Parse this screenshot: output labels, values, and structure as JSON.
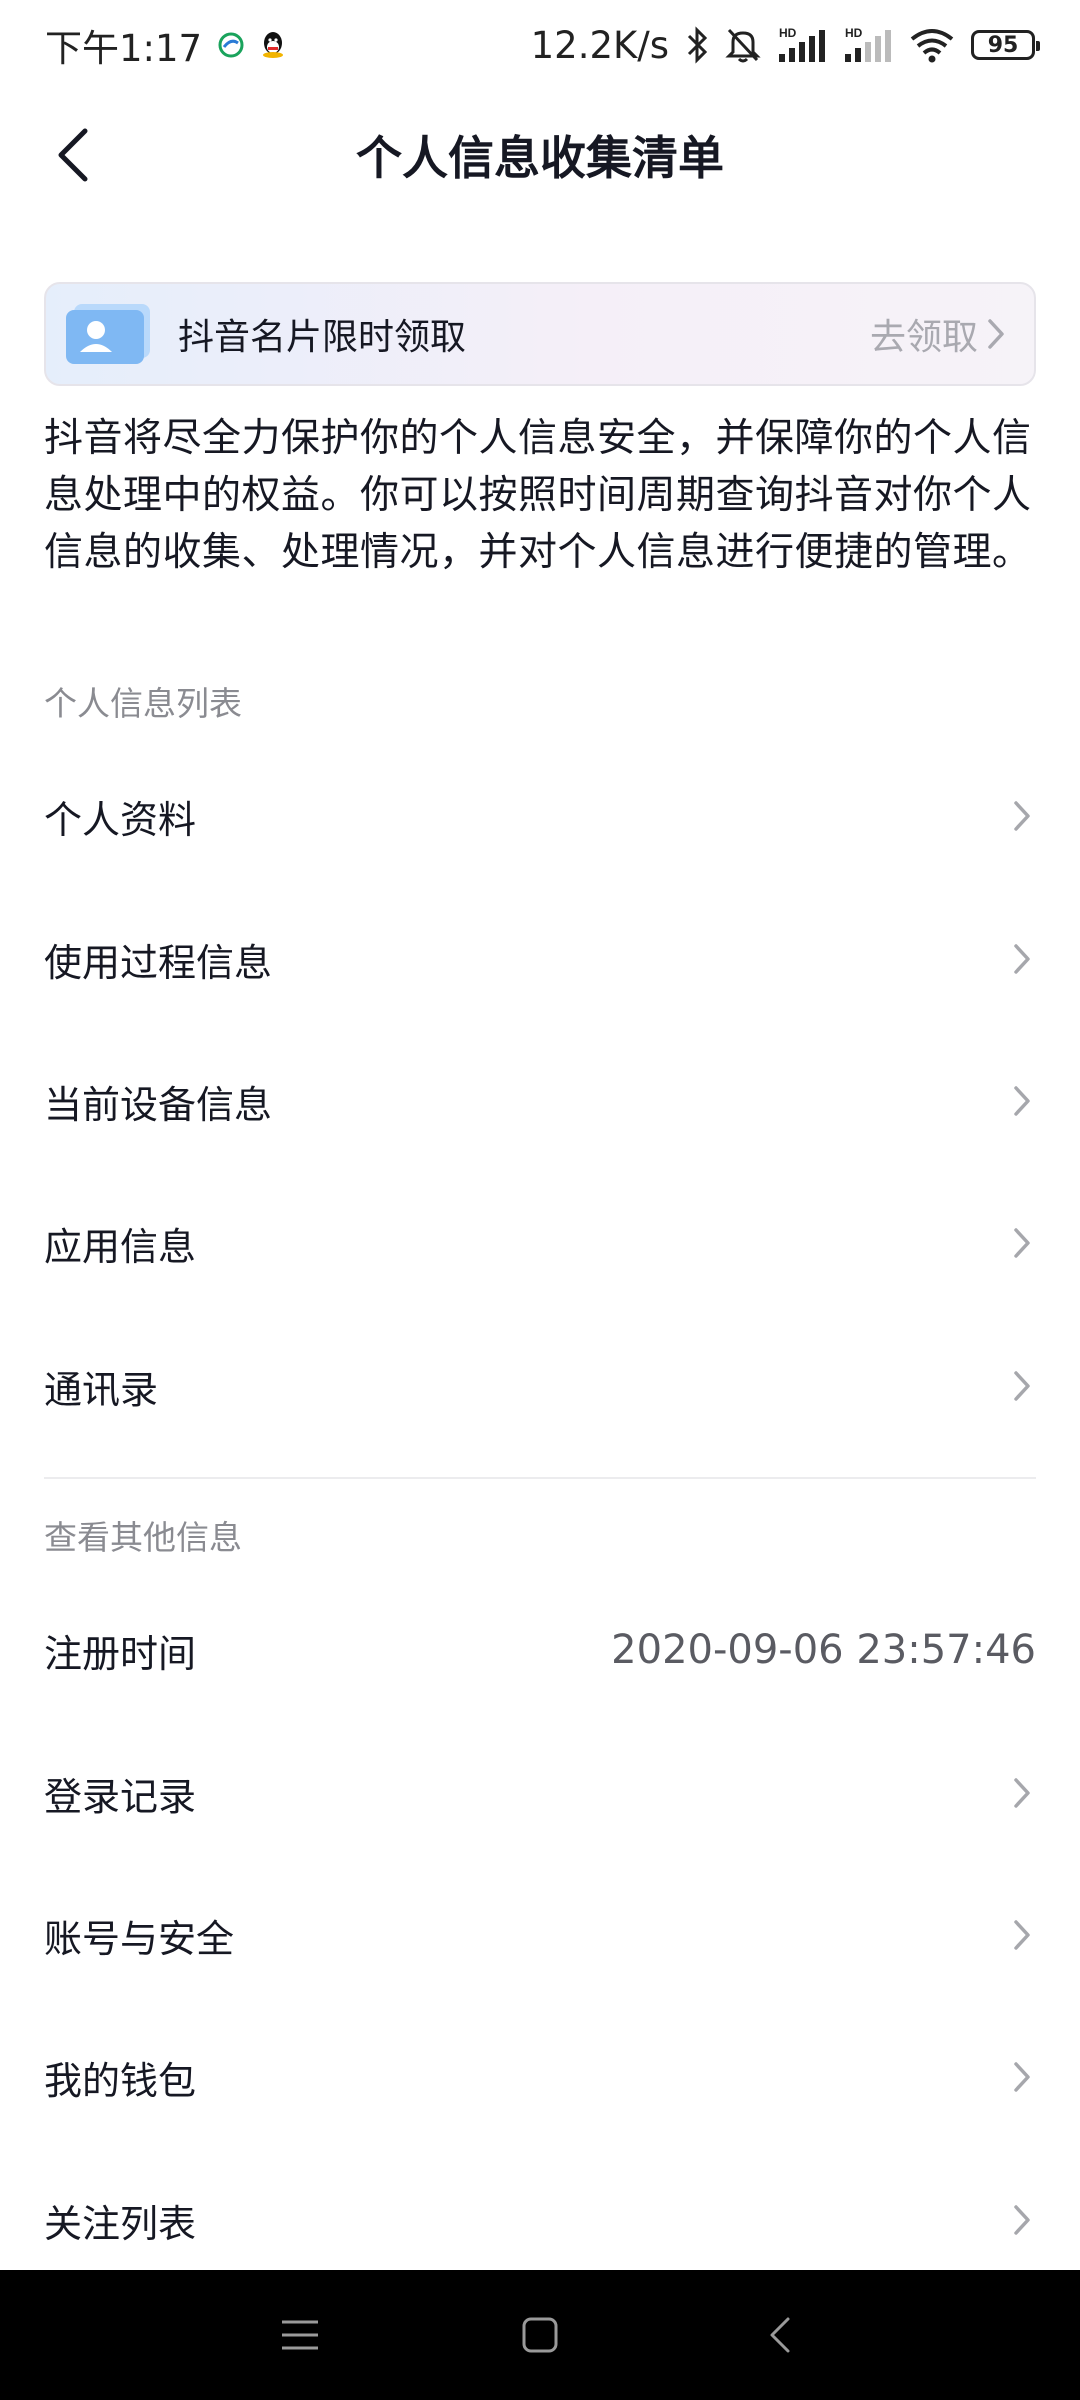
{
  "status_bar": {
    "time": "下午1:17",
    "network_speed": "12.2K/s",
    "battery": "95",
    "hd1": "HD",
    "hd2": "HD",
    "icons": [
      "carrier-icon",
      "qq-icon",
      "bluetooth-icon",
      "mute-icon",
      "signal-icon",
      "signal-icon",
      "wifi-icon",
      "battery-icon"
    ]
  },
  "header": {
    "title": "个人信息收集清单",
    "back_icon": "chevron-left-icon"
  },
  "banner": {
    "title": "抖音名片限时领取",
    "action": "去领取"
  },
  "description": "抖音将尽全力保护你的个人信息安全，并保障你的个人信息处理中的权益。你可以按照时间周期查询抖音对你个人信息的收集、处理情况，并对个人信息进行便捷的管理。",
  "section_personal": {
    "label": "个人信息列表",
    "items": [
      {
        "label": "个人资料"
      },
      {
        "label": "使用过程信息"
      },
      {
        "label": "当前设备信息"
      },
      {
        "label": "应用信息"
      },
      {
        "label": "通讯录"
      }
    ]
  },
  "section_other": {
    "label": "查看其他信息",
    "items": [
      {
        "label": "注册时间",
        "value": "2020-09-06 23:57:46"
      },
      {
        "label": "登录记录"
      },
      {
        "label": "账号与安全"
      },
      {
        "label": "我的钱包"
      },
      {
        "label": "关注列表"
      }
    ]
  },
  "colors": {
    "text_primary": "#161823",
    "text_secondary": "#8a8b91",
    "chevron": "#a6a7ac",
    "banner_card": "#8fc1f5"
  }
}
